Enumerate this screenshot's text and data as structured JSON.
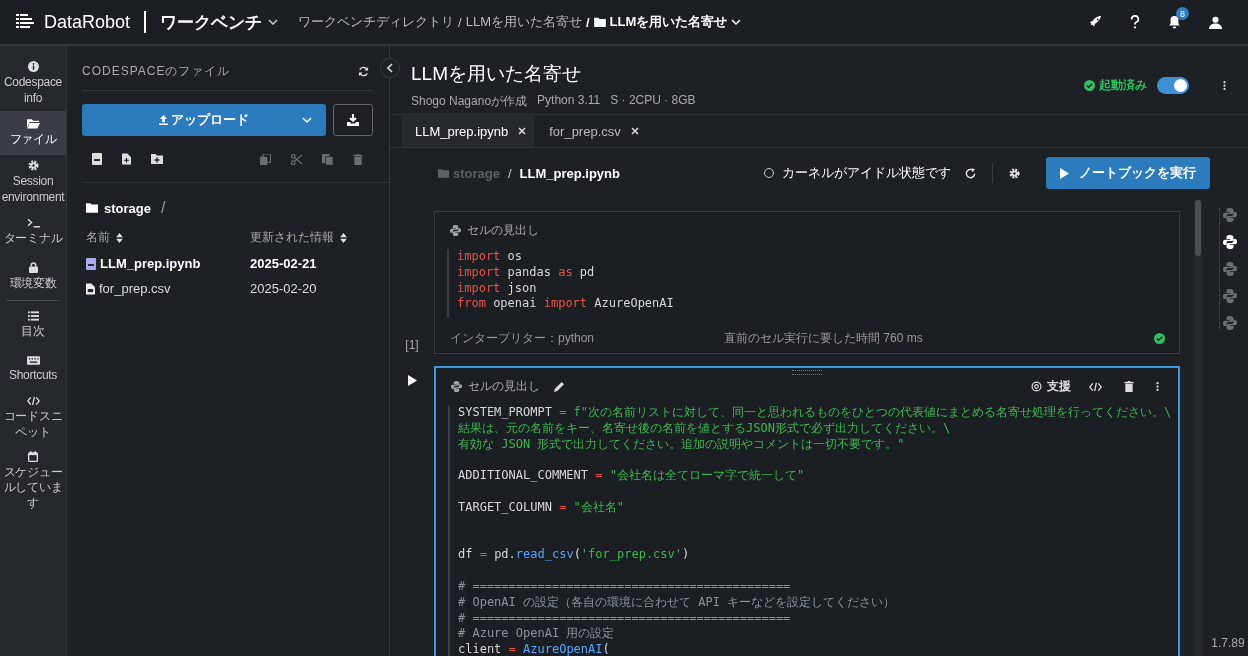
{
  "topbar": {
    "brand": "DataRobot",
    "app": "ワークベンチ",
    "breadcrumb": [
      {
        "label": "ワークベンチディレクトリ",
        "current": false
      },
      {
        "separator": "/",
        "label": "LLMを用いた名寄せ",
        "current": false
      },
      {
        "separator": "/",
        "label": "LLMを用いた名寄せ",
        "current": true
      }
    ],
    "notification_count": "8"
  },
  "rail": [
    {
      "label": "Codespace info",
      "selected": false
    },
    {
      "label": "ファイル",
      "selected": true
    },
    {
      "label": "Session environment",
      "selected": false
    },
    {
      "label": "ターミナル",
      "selected": false
    },
    {
      "label": "環境変数",
      "selected": false
    },
    {
      "label": "目次",
      "selected": false
    },
    {
      "label": "Shortcuts",
      "selected": false
    },
    {
      "label": "コードスニペット",
      "selected": false
    },
    {
      "label": "スケジュールしています",
      "selected": false
    }
  ],
  "files_panel": {
    "title": "CODESPACEのファイル",
    "upload_button": "アップロード",
    "folder": "storage",
    "folder_separator": "/",
    "columns": [
      "名前",
      "更新された情報"
    ],
    "files": [
      {
        "name": "LLM_prep.ipynb",
        "date": "2025-02-21",
        "kind": "notebook",
        "open": true
      },
      {
        "name": "for_prep.csv",
        "date": "2025-02-20",
        "kind": "csv",
        "open": false
      }
    ]
  },
  "codespace": {
    "title": "LLMを用いた名寄せ",
    "author": "Shogo Naganoが作成",
    "python": "Python 3.11",
    "resources": "S · 2CPU · 8GB",
    "status": "起動済み",
    "running": true
  },
  "tabs": [
    {
      "label": "LLM_prep.ipynb",
      "selected": true
    },
    {
      "label": "for_prep.csv",
      "selected": false
    }
  ],
  "notebook": {
    "path_root": "storage",
    "path_separator": "/",
    "path_file": "LLM_prep.ipynb",
    "kernel_status": "カーネルがアイドル状態です",
    "run_button": "ノートブックを実行",
    "version": "1.7.89",
    "cells": [
      {
        "title": "セルの見出し",
        "active": false,
        "counter": "[1]",
        "interpreter": "インタープリター：python",
        "exec_time": "直前のセル実行に要した時間 760 ms",
        "success": true,
        "lines": [
          {
            "kind": "code",
            "tokens": [
              {
                "t": "import",
                "kind": "kw"
              },
              {
                "t": " os",
                "kind": "text"
              }
            ]
          },
          {
            "kind": "code",
            "tokens": [
              {
                "t": "import",
                "kind": "kw"
              },
              {
                "t": " pandas ",
                "kind": "text"
              },
              {
                "t": "as",
                "kind": "kw"
              },
              {
                "t": " pd",
                "kind": "text"
              }
            ]
          },
          {
            "kind": "code",
            "tokens": [
              {
                "t": "import",
                "kind": "kw"
              },
              {
                "t": " json",
                "kind": "text"
              }
            ]
          },
          {
            "kind": "code",
            "tokens": [
              {
                "t": "from",
                "kind": "kw"
              },
              {
                "t": " openai ",
                "kind": "text"
              },
              {
                "t": "import",
                "kind": "kw"
              },
              {
                "t": " AzureOpenAI",
                "kind": "text"
              }
            ]
          }
        ]
      },
      {
        "title": "セルの見出し",
        "active": true,
        "assist": "支援",
        "lines": [
          {
            "kind": "code",
            "tokens": [
              {
                "t": "SYSTEM_PROMPT",
                "kind": "text"
              },
              {
                "t": " = ",
                "kind": "op"
              },
              {
                "t": "f\"次の名前リストに対して、同一と思われるものをひとつの代表値にまとめる名寄せ処理を行ってください。\\",
                "kind": "str"
              }
            ]
          },
          {
            "kind": "code",
            "tokens": [
              {
                "t": "結果は、元の名前をキー、名寄せ後の名前を値とするJSON形式で必ず出力してください。\\",
                "kind": "str"
              }
            ]
          },
          {
            "kind": "code",
            "tokens": [
              {
                "t": "有効な JSON 形式で出力してください。追加の説明やコメントは一切不要です。\"",
                "kind": "str"
              }
            ]
          },
          {
            "kind": "blank"
          },
          {
            "kind": "code",
            "tokens": [
              {
                "t": "ADDITIONAL_COMMENT",
                "kind": "text"
              },
              {
                "t": " = ",
                "kind": "op"
              },
              {
                "t": "\"会社名は全てローマ字で統一して\"",
                "kind": "str"
              }
            ]
          },
          {
            "kind": "blank"
          },
          {
            "kind": "code",
            "tokens": [
              {
                "t": "TARGET_COLUMN",
                "kind": "text"
              },
              {
                "t": " = ",
                "kind": "op"
              },
              {
                "t": "\"会社名\"",
                "kind": "str"
              }
            ]
          },
          {
            "kind": "blank"
          },
          {
            "kind": "blank"
          },
          {
            "kind": "code",
            "tokens": [
              {
                "t": "df",
                "kind": "text"
              },
              {
                "t": " = ",
                "kind": "op"
              },
              {
                "t": "pd.",
                "kind": "text"
              },
              {
                "t": "read_csv",
                "kind": "fn"
              },
              {
                "t": "(",
                "kind": "text"
              },
              {
                "t": "'for_prep.csv'",
                "kind": "str"
              },
              {
                "t": ")",
                "kind": "text"
              }
            ]
          },
          {
            "kind": "blank"
          },
          {
            "kind": "code",
            "tokens": [
              {
                "t": "# ============================================",
                "kind": "comment"
              }
            ]
          },
          {
            "kind": "code",
            "tokens": [
              {
                "t": "# OpenAI の設定（各自の環境に合わせて API キーなどを設定してください）",
                "kind": "comment"
              }
            ]
          },
          {
            "kind": "code",
            "tokens": [
              {
                "t": "# ============================================",
                "kind": "comment"
              }
            ]
          },
          {
            "kind": "code",
            "tokens": [
              {
                "t": "# Azure OpenAI 用の設定",
                "kind": "comment"
              }
            ]
          },
          {
            "kind": "code",
            "tokens": [
              {
                "t": "client",
                "kind": "text"
              },
              {
                "t": " = ",
                "kind": "op"
              },
              {
                "t": "AzureOpenAI",
                "kind": "fn"
              },
              {
                "t": "(",
                "kind": "text"
              }
            ]
          }
        ]
      }
    ]
  }
}
